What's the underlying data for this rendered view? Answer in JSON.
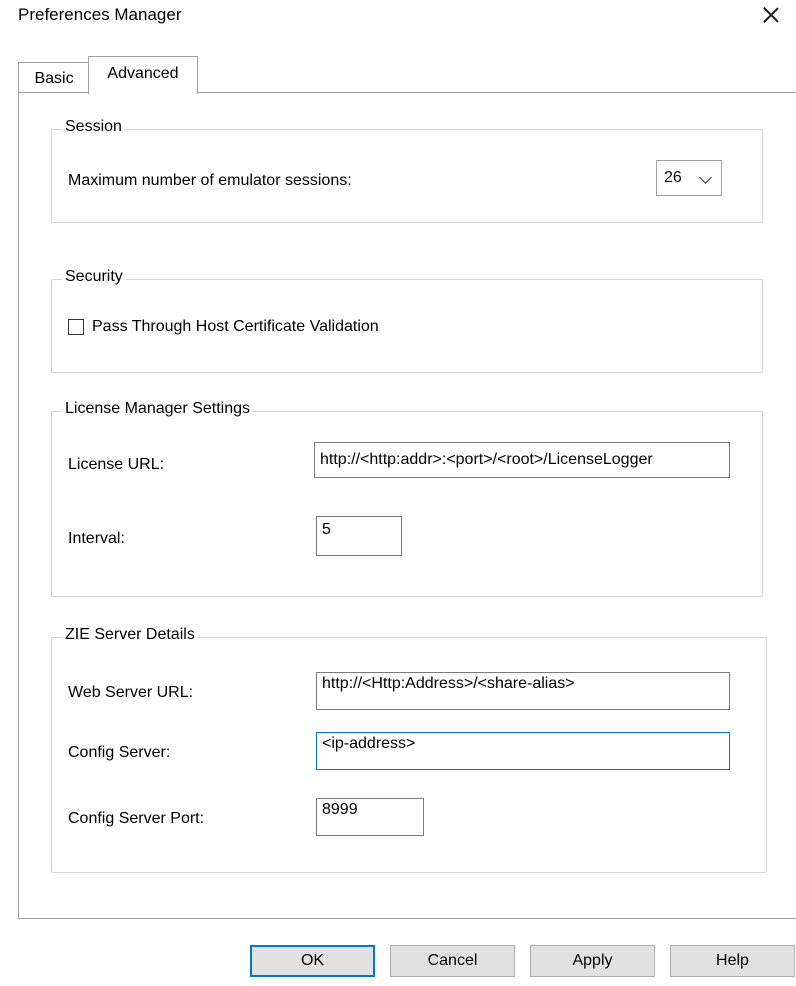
{
  "window": {
    "title": "Preferences Manager"
  },
  "tabs": [
    {
      "label": "Basic"
    },
    {
      "label": "Advanced"
    }
  ],
  "session": {
    "title": "Session",
    "max_sessions_label": "Maximum number of emulator sessions:",
    "max_sessions_value": "26"
  },
  "security": {
    "title": "Security",
    "pass_through_label": "Pass Through Host Certificate Validation",
    "pass_through_checked": false
  },
  "license": {
    "title": "License Manager Settings",
    "url_label": "License URL:",
    "url_value": "http://<http:addr>:<port>/<root>/LicenseLogger",
    "interval_label": "Interval:",
    "interval_value": "5"
  },
  "zie": {
    "title": "ZIE Server Details",
    "web_url_label": "Web Server URL:",
    "web_url_value": "http://<Http:Address>/<share-alias>",
    "config_server_label": "Config Server:",
    "config_server_value": "<ip-address>",
    "config_port_label": "Config Server Port:",
    "config_port_value": "8999"
  },
  "buttons": {
    "ok": "OK",
    "cancel": "Cancel",
    "apply": "Apply",
    "help": "Help"
  }
}
